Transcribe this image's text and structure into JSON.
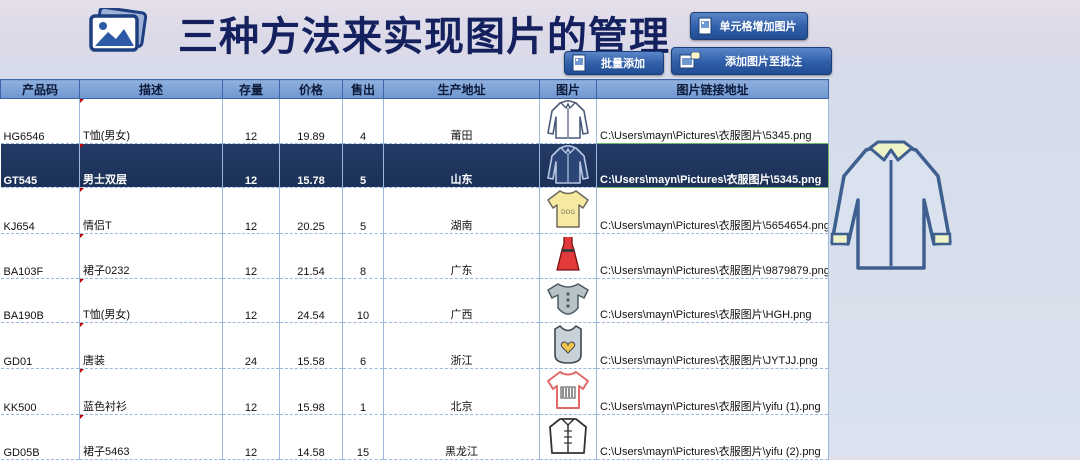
{
  "header": {
    "title": "三种方法来实现图片的管理",
    "buttons": {
      "cell_add": "单元格增加图片",
      "batch_add": "批量添加",
      "add_to_comment": "添加图片至批注"
    }
  },
  "table": {
    "columns": [
      "产品码",
      "描述",
      "存量",
      "价格",
      "售出",
      "生产地址",
      "图片",
      "图片链接地址"
    ],
    "selected_row": 1,
    "rows": [
      {
        "code": "HG6546",
        "desc": "T恤(男女)",
        "stock": "12",
        "price": "19.89",
        "sold": "4",
        "origin": "莆田",
        "image": "shirt-outline-icon",
        "link": "C:\\Users\\mayn\\Pictures\\衣服图片\\5345.png"
      },
      {
        "code": "GT545",
        "desc": "男士双层",
        "stock": "12",
        "price": "15.78",
        "sold": "5",
        "origin": "山东",
        "image": "shirt-outline-icon",
        "link": "C:\\Users\\mayn\\Pictures\\衣服图片\\5345.png"
      },
      {
        "code": "KJ654",
        "desc": "情侣T",
        "stock": "12",
        "price": "20.25",
        "sold": "5",
        "origin": "湖南",
        "image": "yellow-tshirt-icon",
        "link": "C:\\Users\\mayn\\Pictures\\衣服图片\\5654654.png"
      },
      {
        "code": "BA103F",
        "desc": "裙子0232",
        "stock": "12",
        "price": "21.54",
        "sold": "8",
        "origin": "广东",
        "image": "red-dress-icon",
        "link": "C:\\Users\\mayn\\Pictures\\衣服图片\\9879879.png"
      },
      {
        "code": "BA190B",
        "desc": "T恤(男女)",
        "stock": "12",
        "price": "24.54",
        "sold": "10",
        "origin": "广西",
        "image": "baby-onesie-icon",
        "link": "C:\\Users\\mayn\\Pictures\\衣服图片\\HGH.png"
      },
      {
        "code": "GD01",
        "desc": "唐装",
        "stock": "24",
        "price": "15.58",
        "sold": "6",
        "origin": "浙江",
        "image": "bib-heart-icon",
        "link": "C:\\Users\\mayn\\Pictures\\衣服图片\\JYTJJ.png"
      },
      {
        "code": "KK500",
        "desc": "蓝色衬衫",
        "stock": "12",
        "price": "15.98",
        "sold": "1",
        "origin": "北京",
        "image": "striped-tshirt-icon",
        "link": "C:\\Users\\mayn\\Pictures\\衣服图片\\yifu (1).png"
      },
      {
        "code": "GD05B",
        "desc": "裙子5463",
        "stock": "12",
        "price": "14.58",
        "sold": "15",
        "origin": "黑龙江",
        "image": "chinese-jacket-icon",
        "link": "C:\\Users\\mayn\\Pictures\\衣服图片\\yifu (2).png"
      }
    ]
  },
  "preview": {
    "image": "large-shirt-preview-icon"
  },
  "colors": {
    "title": "#14215e",
    "header_bg": "#7aa0d6",
    "selected_row": "#1f355e",
    "comment_marker": "#c00000"
  }
}
